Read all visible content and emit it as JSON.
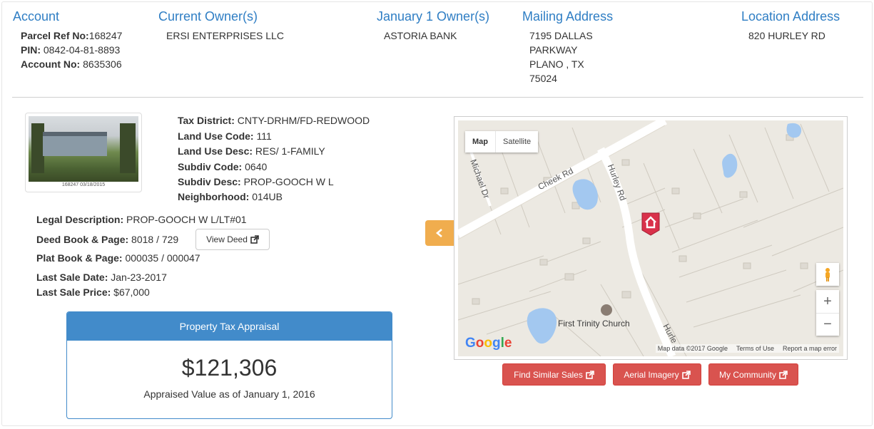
{
  "header": {
    "account_title": "Account",
    "owner_title": "Current Owner(s)",
    "jan_owner_title": "January 1 Owner(s)",
    "mailing_title": "Mailing Address",
    "location_title": "Location Address",
    "parcel_label": "Parcel Ref No:",
    "parcel_value": "168247",
    "pin_label": "PIN:",
    "pin_value": " 0842-04-81-8893",
    "account_label": "Account No:",
    "account_value": " 8635306",
    "current_owner": "ERSI ENTERPRISES LLC",
    "jan_owner": "ASTORIA BANK",
    "mailing_line1": "7195 DALLAS",
    "mailing_line2": "PARKWAY",
    "mailing_line3": "PLANO , TX",
    "mailing_line4": "75024",
    "location": "820 HURLEY RD"
  },
  "photo": {
    "caption": "168247  03/18/2015"
  },
  "details": {
    "tax_district_label": "Tax District:",
    "tax_district_value": " CNTY-DRHM/FD-REDWOOD",
    "land_use_code_label": "Land Use Code:",
    "land_use_code_value": " 111",
    "land_use_desc_label": "Land Use Desc:",
    "land_use_desc_value": " RES/ 1-FAMILY",
    "subdiv_code_label": "Subdiv Code:",
    "subdiv_code_value": " 0640",
    "subdiv_desc_label": "Subdiv Desc:",
    "subdiv_desc_value": " PROP-GOOCH W L",
    "neighborhood_label": "Neighborhood:",
    "neighborhood_value": " 014UB",
    "legal_label": "Legal Description:",
    "legal_value": " PROP-GOOCH W L/LT#01",
    "deed_label": "Deed Book & Page:",
    "deed_value": " 8018 / 729",
    "view_deed": "View Deed",
    "plat_label": "Plat Book & Page:",
    "plat_value": " 000035 / 000047",
    "sale_date_label": "Last Sale Date:",
    "sale_date_value": " Jan-23-2017",
    "sale_price_label": "Last Sale Price:",
    "sale_price_value": " $67,000"
  },
  "appraisal": {
    "title": "Property Tax Appraisal",
    "value": "$121,306",
    "subtitle": "Appraised Value as of January 1, 2016"
  },
  "map": {
    "type_map": "Map",
    "type_satellite": "Satellite",
    "road_cheek": "Cheek Rd",
    "road_hurley": "Hurley Rd",
    "road_michael": "Michael Dr",
    "road_hurley2": "Hurle",
    "church": "First Trinity Church",
    "google": "Google",
    "attrib_data": "Map data ©2017 Google",
    "attrib_terms": "Terms of Use",
    "attrib_report": "Report a map error",
    "zoom_in": "+",
    "zoom_out": "−"
  },
  "buttons": {
    "similar_sales": "Find Similar Sales",
    "aerial": "Aerial Imagery",
    "community": "My Community"
  },
  "colors": {
    "link_blue": "#2f7ec4",
    "panel_blue": "#428bca",
    "danger": "#d9534f",
    "warning": "#f0ad4e"
  }
}
